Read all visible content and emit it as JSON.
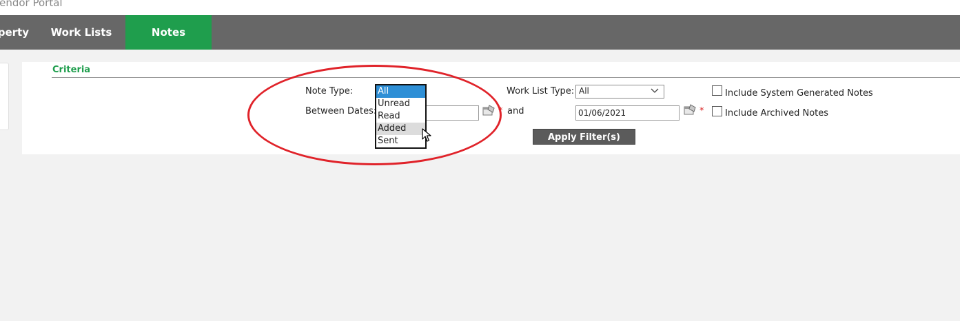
{
  "app": {
    "title": "Vendor Portal"
  },
  "nav": {
    "items": [
      {
        "label": "Property"
      },
      {
        "label": "Work Lists"
      },
      {
        "label": "Notes"
      }
    ]
  },
  "criteria": {
    "title": "Criteria",
    "note_type_label": "Note Type:",
    "note_type_options": [
      "All",
      "Unread",
      "Read",
      "Added",
      "Sent"
    ],
    "note_type_selected": "All",
    "between_dates_label": "Between Dates:",
    "start_date_value": "",
    "and_label": "and",
    "end_date_value": "01/06/2021",
    "required_mark": "*",
    "work_list_type_label": "Work List Type:",
    "work_list_type_value": "All",
    "include_system_label": "Include System Generated Notes",
    "include_archived_label": "Include Archived Notes",
    "apply_label": "Apply Filter(s)"
  },
  "colors": {
    "nav_bg": "#676767",
    "nav_active": "#1f9e4d",
    "accent_green": "#1f9e4d",
    "selected_blue": "#2e8fd6",
    "required_red": "#d92020",
    "annotation_red": "#e0232a"
  },
  "icons": [
    "calendar-icon",
    "chevron-down-icon",
    "mouse-pointer-icon"
  ]
}
